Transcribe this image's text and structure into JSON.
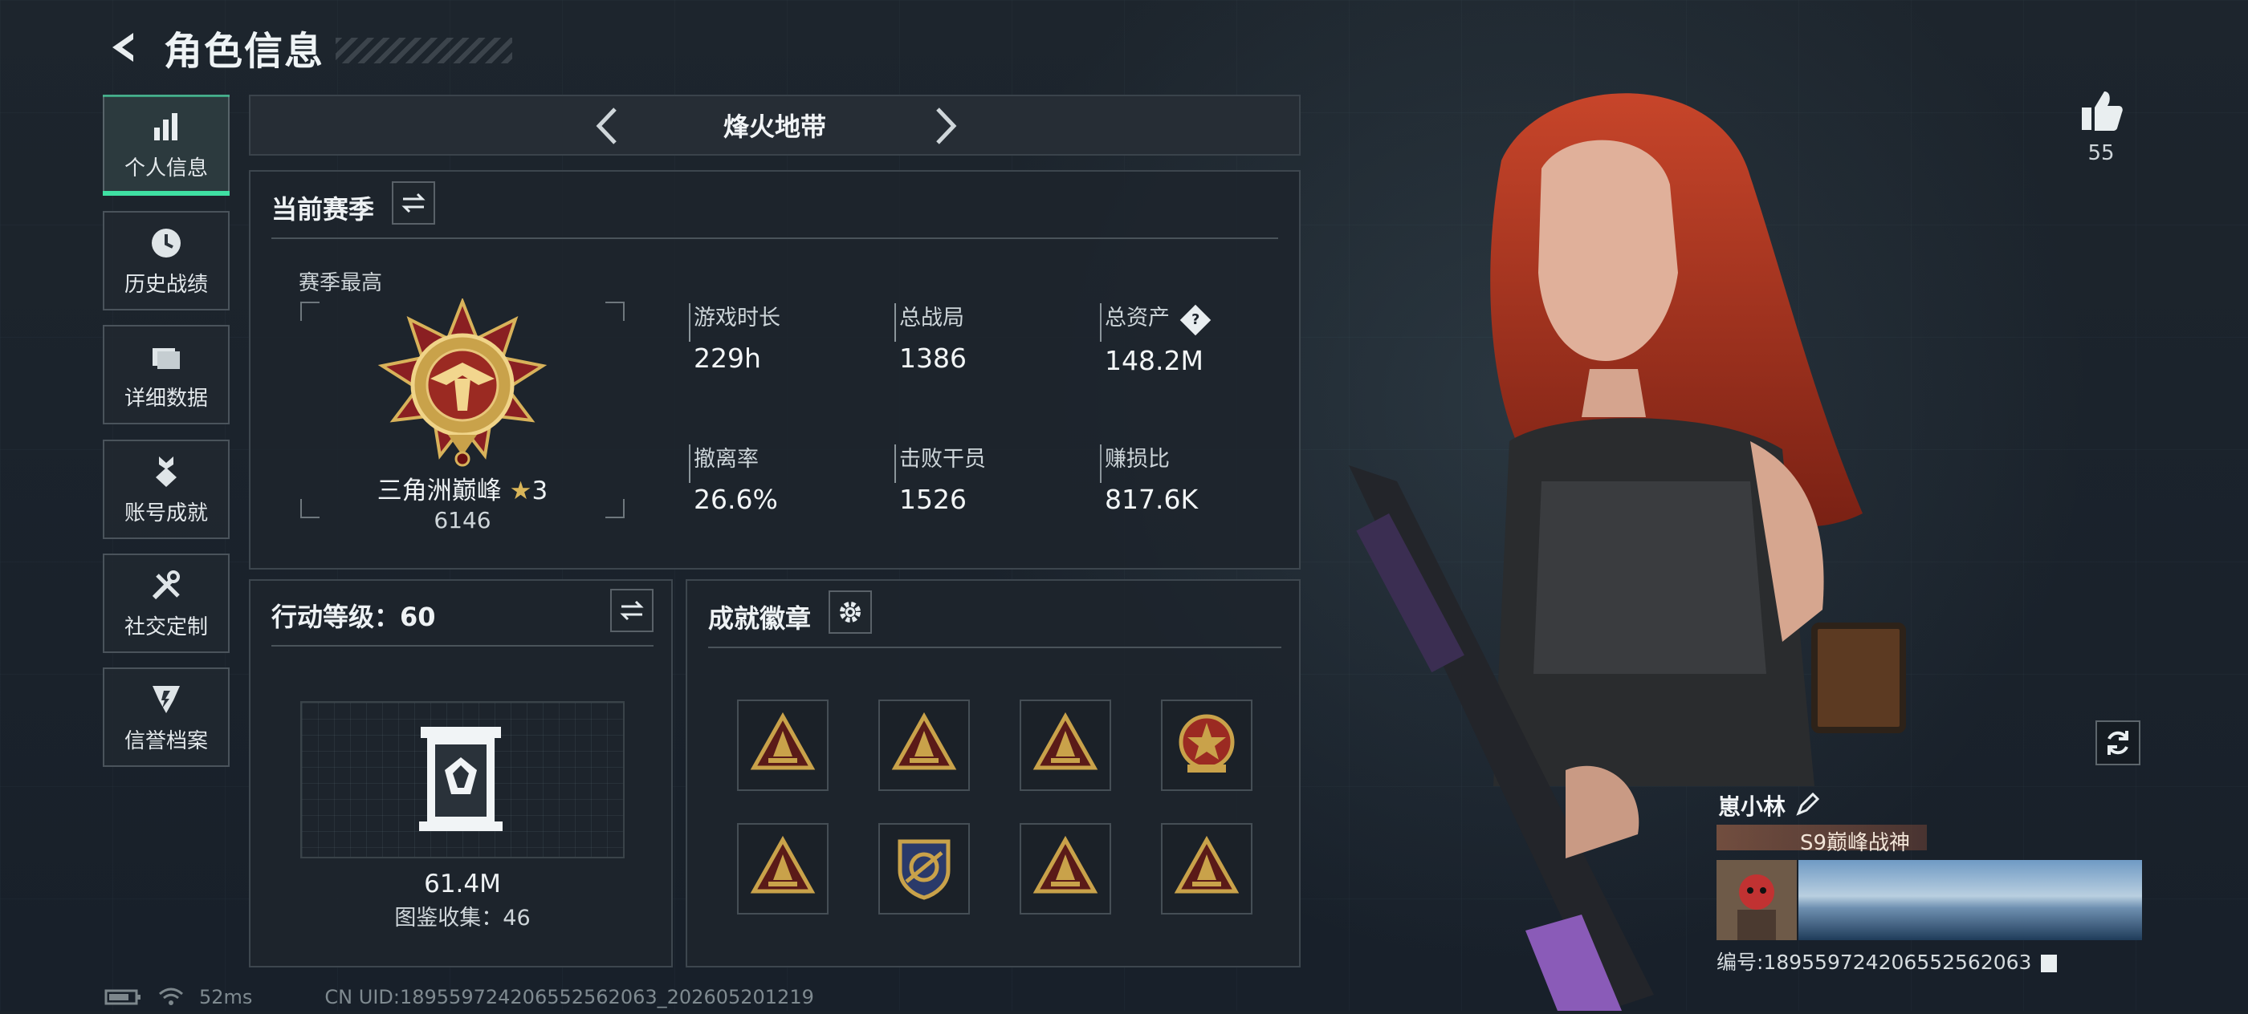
{
  "header": {
    "title": "角色信息"
  },
  "sidebar": {
    "items": [
      {
        "label": "个人信息",
        "icon": "bar-chart-icon",
        "active": true
      },
      {
        "label": "历史战绩",
        "icon": "clock-icon",
        "active": false
      },
      {
        "label": "详细数据",
        "icon": "folder-icon",
        "active": false
      },
      {
        "label": "账号成就",
        "icon": "medal-icon",
        "active": false
      },
      {
        "label": "社交定制",
        "icon": "tools-icon",
        "active": false
      },
      {
        "label": "信誉档案",
        "icon": "shield-icon",
        "active": false
      }
    ]
  },
  "mode": {
    "label": "烽火地带"
  },
  "season": {
    "title": "当前赛季",
    "best_label": "赛季最高",
    "rank_name": "三角洲巅峰",
    "rank_stars": "3",
    "rank_score": "6146",
    "stats": [
      {
        "label": "游戏时长",
        "value": "229h"
      },
      {
        "label": "总战局",
        "value": "1386"
      },
      {
        "label": "总资产",
        "value": "148.2M",
        "help": "?"
      },
      {
        "label": "撤离率",
        "value": "26.6%"
      },
      {
        "label": "击败干员",
        "value": "1526"
      },
      {
        "label": "赚损比",
        "value": "817.6K"
      }
    ]
  },
  "level": {
    "title": "行动等级：60",
    "collection_value": "61.4M",
    "collection_label": "图鉴收集：46"
  },
  "badges": {
    "title": "成就徽章",
    "items": [
      {
        "icon": "triangle-badge-icon"
      },
      {
        "icon": "triangle-badge-icon"
      },
      {
        "icon": "triangle-badge-icon"
      },
      {
        "icon": "star-medal-icon"
      },
      {
        "icon": "triangle-badge-icon"
      },
      {
        "icon": "shield-badge-icon"
      },
      {
        "icon": "triangle-badge-icon"
      },
      {
        "icon": "triangle-badge-icon"
      }
    ]
  },
  "profile": {
    "likes": "55",
    "player_name": "崽小林",
    "title_tag": "S9巅峰战神",
    "player_id": "编号:18955972420655256​2063"
  },
  "footer": {
    "ping": "52ms",
    "uid": "CN UID:18955972420655256​2063_202605201219"
  },
  "colors": {
    "accent": "#3fe0a3",
    "gold": "#c9a24a",
    "panel_border": "#3d464e"
  }
}
